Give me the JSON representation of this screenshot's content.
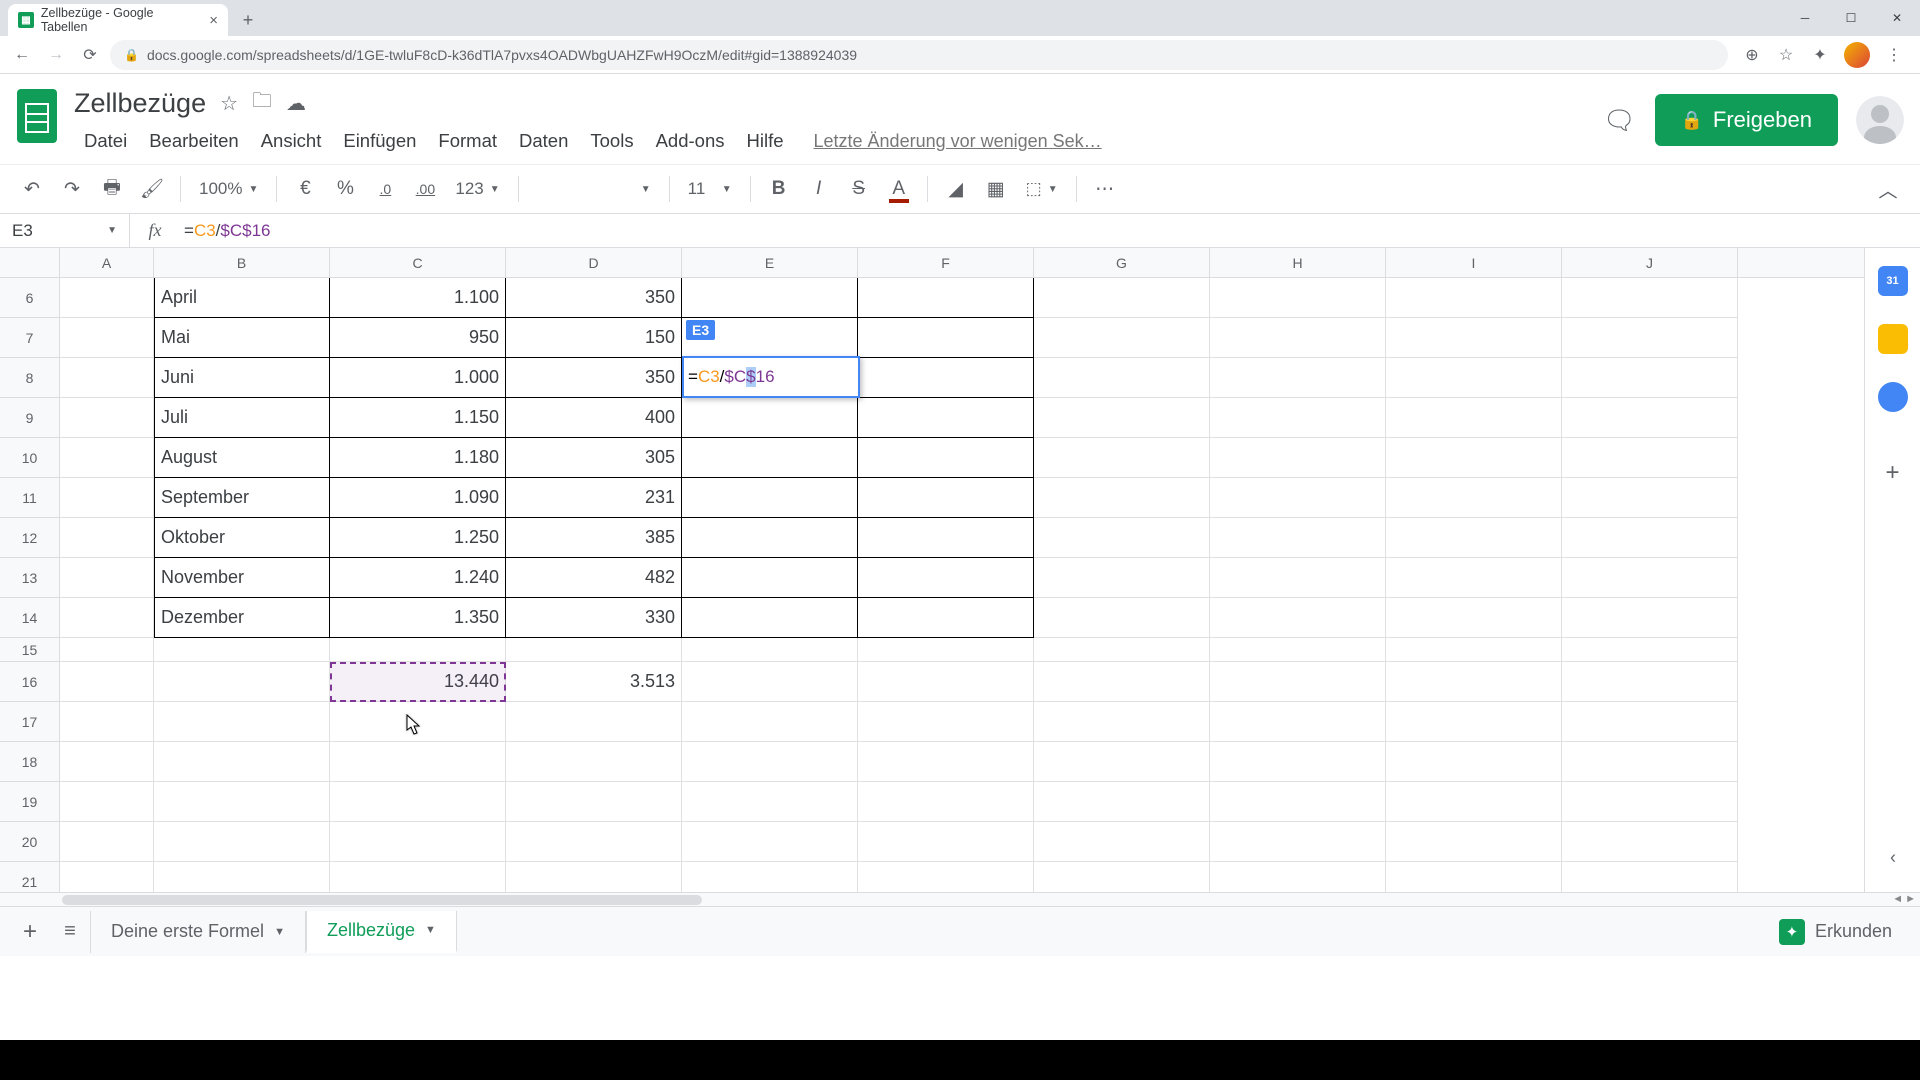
{
  "browser": {
    "tab_title": "Zellbezüge - Google Tabellen",
    "url": "docs.google.com/spreadsheets/d/1GE-twluF8cD-k36dTlA7pvxs4OADWbgUAHZFwH9OczM/edit#gid=1388924039"
  },
  "doc": {
    "title": "Zellbezüge",
    "last_edit": "Letzte Änderung vor wenigen Sek…"
  },
  "menu": {
    "file": "Datei",
    "edit": "Bearbeiten",
    "view": "Ansicht",
    "insert": "Einfügen",
    "format": "Format",
    "data": "Daten",
    "tools": "Tools",
    "addons": "Add-ons",
    "help": "Hilfe"
  },
  "share_label": "Freigeben",
  "toolbar": {
    "zoom": "100%",
    "currency": "€",
    "percent": "%",
    "dec_less": ".0",
    "dec_more": ".00",
    "num_format": "123",
    "font_size": "11"
  },
  "name_box": "E3",
  "formula": {
    "prefix": "=",
    "ref1": "C3",
    "op": "/",
    "ref2": "$C$16"
  },
  "columns": [
    "A",
    "B",
    "C",
    "D",
    "E",
    "F",
    "G",
    "H",
    "I",
    "J"
  ],
  "rows": [
    {
      "n": "6",
      "b": "April",
      "c": "1.100",
      "d": "350"
    },
    {
      "n": "7",
      "b": "Mai",
      "c": "950",
      "d": "150"
    },
    {
      "n": "8",
      "b": "Juni",
      "c": "1.000",
      "d": "350"
    },
    {
      "n": "9",
      "b": "Juli",
      "c": "1.150",
      "d": "400"
    },
    {
      "n": "10",
      "b": "August",
      "c": "1.180",
      "d": "305"
    },
    {
      "n": "11",
      "b": "September",
      "c": "1.090",
      "d": "231"
    },
    {
      "n": "12",
      "b": "Oktober",
      "c": "1.250",
      "d": "385"
    },
    {
      "n": "13",
      "b": "November",
      "c": "1.240",
      "d": "482"
    },
    {
      "n": "14",
      "b": "Dezember",
      "c": "1.350",
      "d": "330"
    }
  ],
  "row16": {
    "n": "16",
    "c": "13.440",
    "d": "3.513"
  },
  "empty_rows": [
    "15",
    "17",
    "18",
    "19",
    "20",
    "21"
  ],
  "edit_overlay": {
    "chip": "E3",
    "t1": "=",
    "t2": "C3",
    "t3": "/",
    "t4": "$C",
    "t5": "$",
    "t6": "16"
  },
  "sheet_tabs": {
    "tab1": "Deine erste Formel",
    "tab2": "Zellbezüge"
  },
  "explore_label": "Erkunden",
  "side_cal_day": "31"
}
